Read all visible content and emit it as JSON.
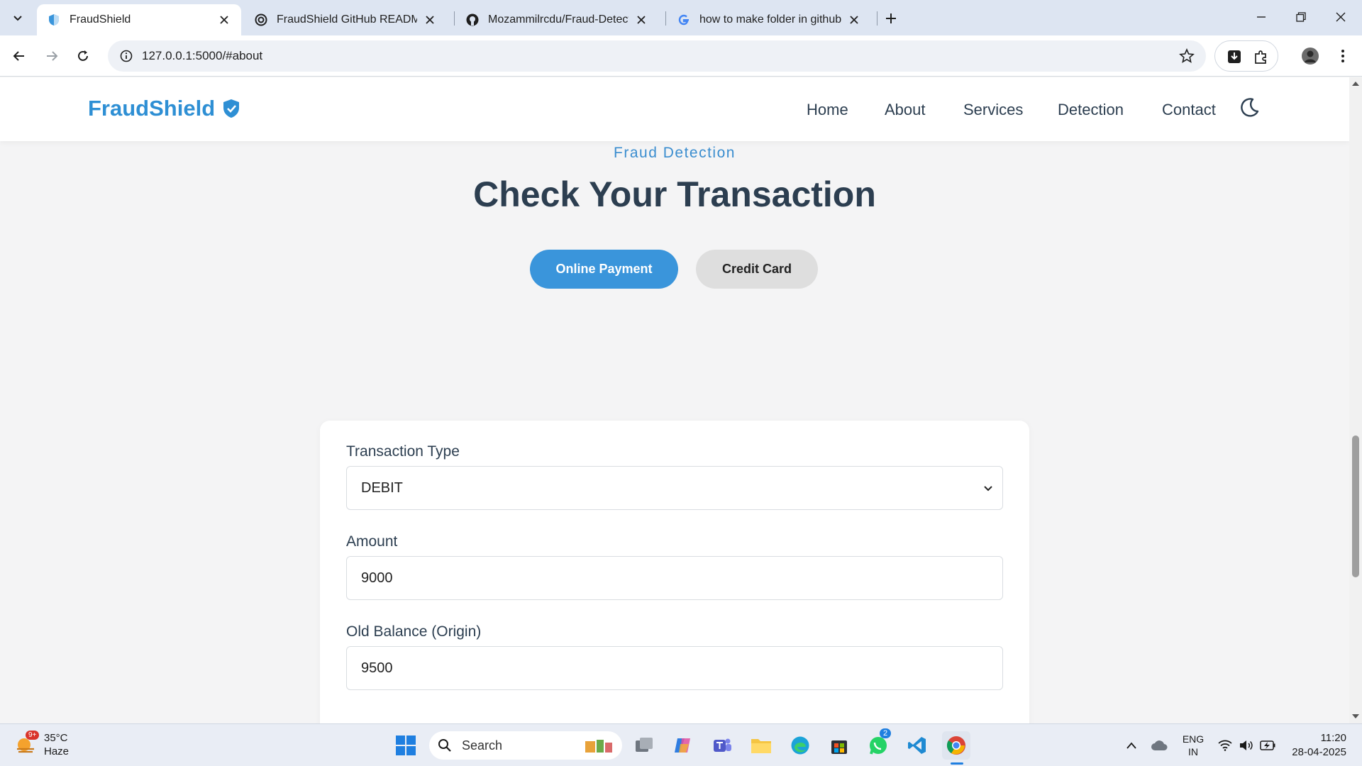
{
  "browser": {
    "tabs": [
      {
        "title": "FraudShield",
        "active": true
      },
      {
        "title": "FraudShield GitHub README",
        "active": false
      },
      {
        "title": "Mozammilrcdu/Fraud-Detectio",
        "active": false
      },
      {
        "title": "how to make folder in github -",
        "active": false
      }
    ],
    "url": "127.0.0.1:5000/#about"
  },
  "site": {
    "brand": "FraudShield",
    "nav": [
      "Home",
      "About",
      "Services",
      "Detection",
      "Contact"
    ],
    "section_subtitle": "Fraud Detection",
    "section_title": "Check Your Transaction",
    "toggle": {
      "online": "Online Payment",
      "credit": "Credit Card"
    },
    "form": {
      "type_label": "Transaction Type",
      "type_value": "DEBIT",
      "amount_label": "Amount",
      "amount_value": "9000",
      "old_balance_label": "Old Balance (Origin)",
      "old_balance_value": "9500"
    },
    "colors": {
      "brand": "#2e8fd4",
      "heading": "#2c3e50",
      "primary_button": "#3a95db"
    }
  },
  "taskbar": {
    "weather_temp": "35°C",
    "weather_desc": "Haze",
    "weather_badge": "9+",
    "search_label": "Search",
    "whatsapp_badge": "2",
    "lang_top": "ENG",
    "lang_bottom": "IN",
    "time": "11:20",
    "date": "28-04-2025"
  }
}
